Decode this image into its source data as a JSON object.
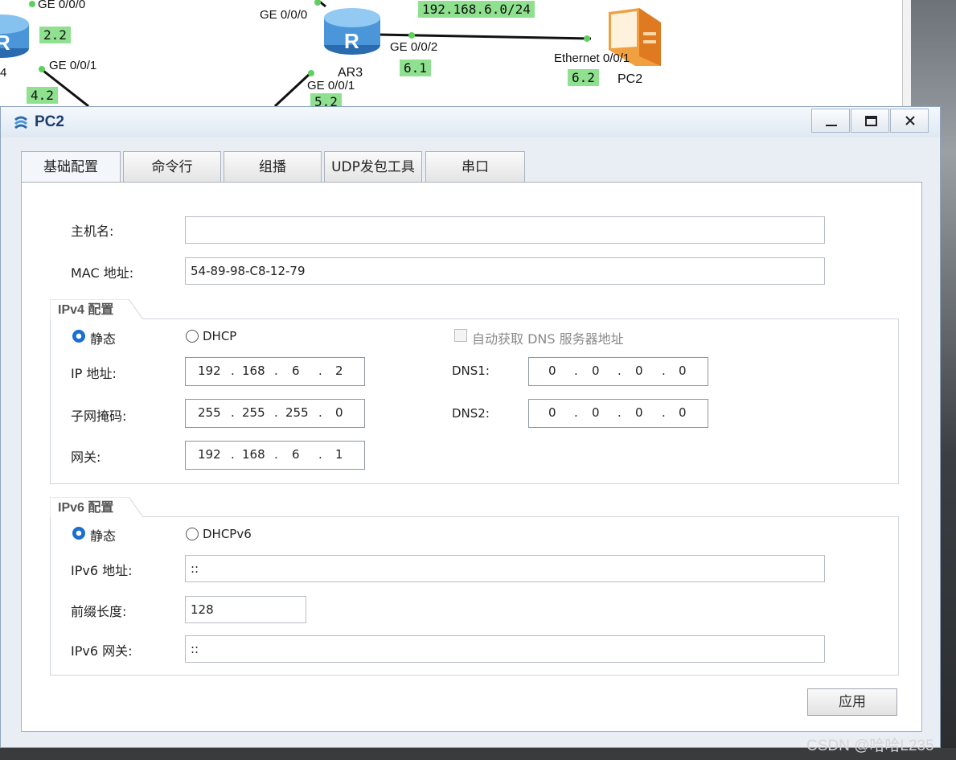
{
  "topology": {
    "labels": {
      "ge000_left": "GE 0/0/0",
      "ge001_left": "GE 0/0/1",
      "router_left_partial": "4",
      "ge000_ar3": "GE 0/0/0",
      "ar3_name": "AR3",
      "ge001_ar3": "GE 0/0/1",
      "ge002_ar3": "GE 0/0/2",
      "eth_pc2": "Ethernet 0/0/1",
      "pc2_name": "PC2"
    },
    "badges": {
      "b22": "2.2",
      "b42": "4.2",
      "b52": "5.2",
      "b61": "6.1",
      "b62": "6.2",
      "net": "192.168.6.0/24"
    }
  },
  "window": {
    "title": "PC2",
    "buttons": [
      "minimize",
      "maximize",
      "close"
    ]
  },
  "tabs": [
    "基础配置",
    "命令行",
    "组播",
    "UDP发包工具",
    "串口"
  ],
  "form": {
    "hostname_label": "主机名:",
    "hostname_value": "",
    "mac_label": "MAC 地址:",
    "mac_value": "54-89-98-C8-12-79",
    "ipv4": {
      "group_title": "IPv4 配置",
      "static_label": "静态",
      "dhcp_label": "DHCP",
      "auto_dns_label": "自动获取 DNS 服务器地址",
      "ip_label": "IP 地址:",
      "ip": [
        "192",
        "168",
        "6",
        "2"
      ],
      "mask_label": "子网掩码:",
      "mask": [
        "255",
        "255",
        "255",
        "0"
      ],
      "gateway_label": "网关:",
      "gateway": [
        "192",
        "168",
        "6",
        "1"
      ],
      "dns1_label": "DNS1:",
      "dns1": [
        "0",
        "0",
        "0",
        "0"
      ],
      "dns2_label": "DNS2:",
      "dns2": [
        "0",
        "0",
        "0",
        "0"
      ]
    },
    "ipv6": {
      "group_title": "IPv6 配置",
      "static_label": "静态",
      "dhcp_label": "DHCPv6",
      "addr_label": "IPv6 地址:",
      "addr_value": "::",
      "prefix_label": "前缀长度:",
      "prefix_value": "128",
      "gateway_label": "IPv6 网关:",
      "gateway_value": "::"
    },
    "apply_label": "应用"
  },
  "watermark": "CSDN @哈哈L235",
  "colors": {
    "accent": "#1b6fd1",
    "badge": "#8fe08f",
    "title": "#1e3d6b"
  }
}
